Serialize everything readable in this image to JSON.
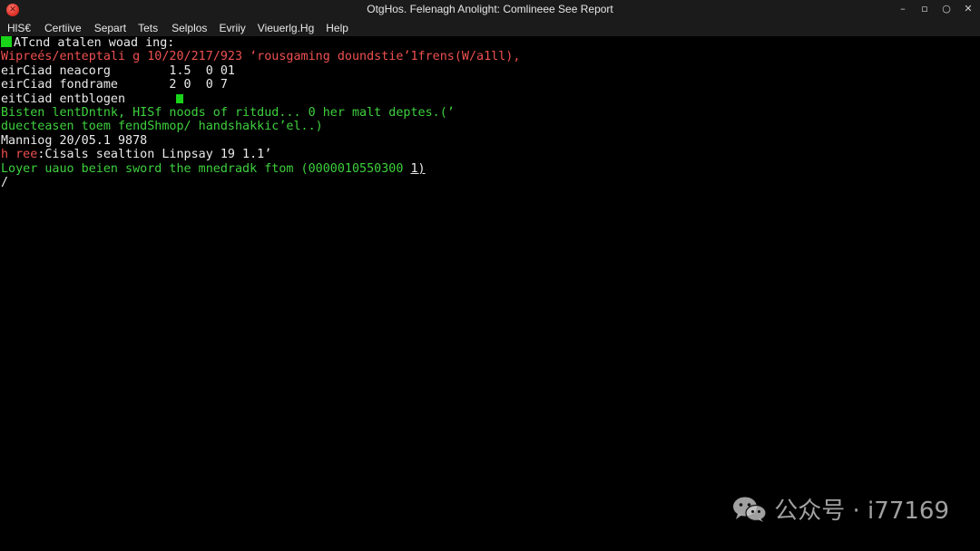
{
  "window": {
    "title": "OtgHos. Felenagh Anolight: Comlineee See Report",
    "controls": [
      "–",
      "▫",
      "○",
      "✕"
    ]
  },
  "menu": [
    "HlS€",
    "Certiive",
    "Separt",
    "Tets",
    "Selplos",
    "Evriiy",
    "Vieuerlg.Hg",
    "Help"
  ],
  "colors": {
    "white": "#eaeaea",
    "red": "#f05050",
    "green": "#3ed13e",
    "cursor": "#19d319",
    "background": "#000000"
  },
  "terminal": {
    "lines": [
      {
        "text": "ATcnd atalen woad ing:",
        "color": "white",
        "cursor_before": true
      },
      {
        "text": "Wipreés/enteptali g 10/20/217/923 ʻrousgaming doundstieʼ1frens(W/a1ll),",
        "color": "red"
      },
      {
        "text": "eirCiad neacorg        1.5  0 01",
        "color": "white"
      },
      {
        "text": "eirCiad fondrame       2 0  0 7",
        "color": "white"
      },
      {
        "text": "eitCiad entblogen",
        "color": "white",
        "cursor_after": true
      },
      {
        "text": "Bisten lentDntnk, HISf noods of ritdud... 0 her malt deptes.(ʼ",
        "color": "green"
      },
      {
        "text": "duecteasen toem fendShmop/ handshakkicʼel..)",
        "color": "green"
      },
      {
        "text": "Manniog 20/05.1 9878",
        "color": "white"
      },
      {
        "text": "h ree:Cisals sealtion Linpsay 19 1.1ʼ",
        "color": "red",
        "split": [
          "h ree",
          ":Cisals sealtion Linpsay 19 1.1ʼ"
        ]
      },
      {
        "text": "Loyer uauo beien sword the mnedradk ftom (0000010550300 ",
        "color": "green",
        "tail": "1)"
      },
      {
        "text": "/",
        "color": "white"
      }
    ]
  },
  "watermark": {
    "text": "公众号 · i77169",
    "logo": "wechat-icon"
  }
}
